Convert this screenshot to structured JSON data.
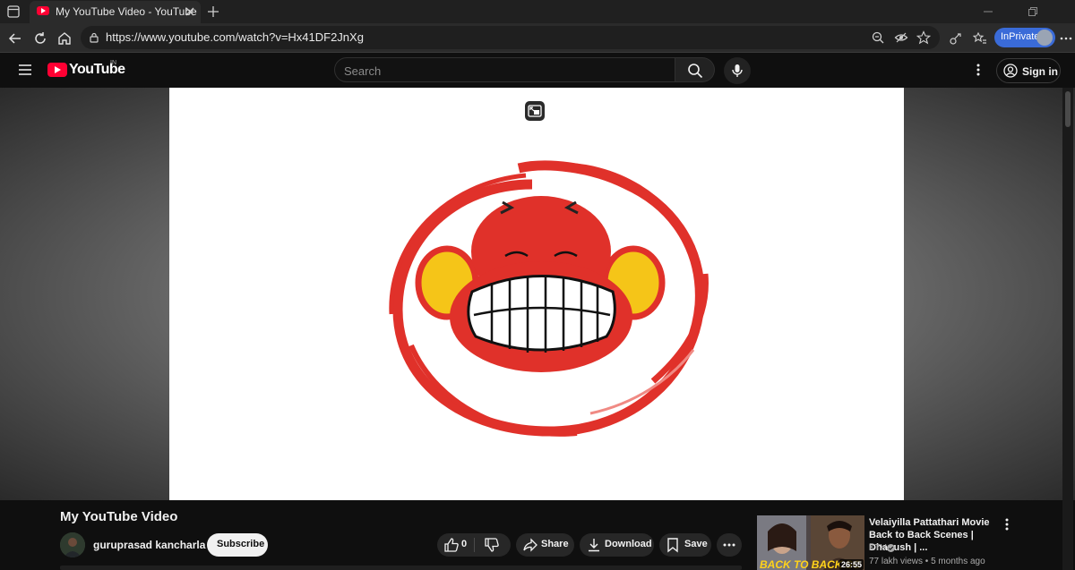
{
  "browser": {
    "tab_title": "My YouTube Video - YouTube",
    "url": "https://www.youtube.com/watch?v=Hx41DF2JnXg",
    "inprivate_label": "InPrivate"
  },
  "header": {
    "logo_text": "YouTube",
    "region": "IN",
    "search_placeholder": "Search",
    "signin_label": "Sign in"
  },
  "video": {
    "title": "My YouTube Video",
    "channel_name": "guruprasad kancharla",
    "subscribe_label": "Subscribe",
    "like_count": "0",
    "share_label": "Share",
    "download_label": "Download",
    "save_label": "Save"
  },
  "recommendation": {
    "title": "Velaiyilla Pattathari Movie Back to Back Scenes | Dhanush | ...",
    "channel": "KTV",
    "meta": "77 lakh views • 5 months ago",
    "duration": "26:55",
    "thumbnail_text": "BACK TO BACK SC"
  },
  "colors": {
    "youtube_red": "#ff0033",
    "inprivate_blue": "#3a6bd8",
    "background": "#0f0f0f"
  }
}
